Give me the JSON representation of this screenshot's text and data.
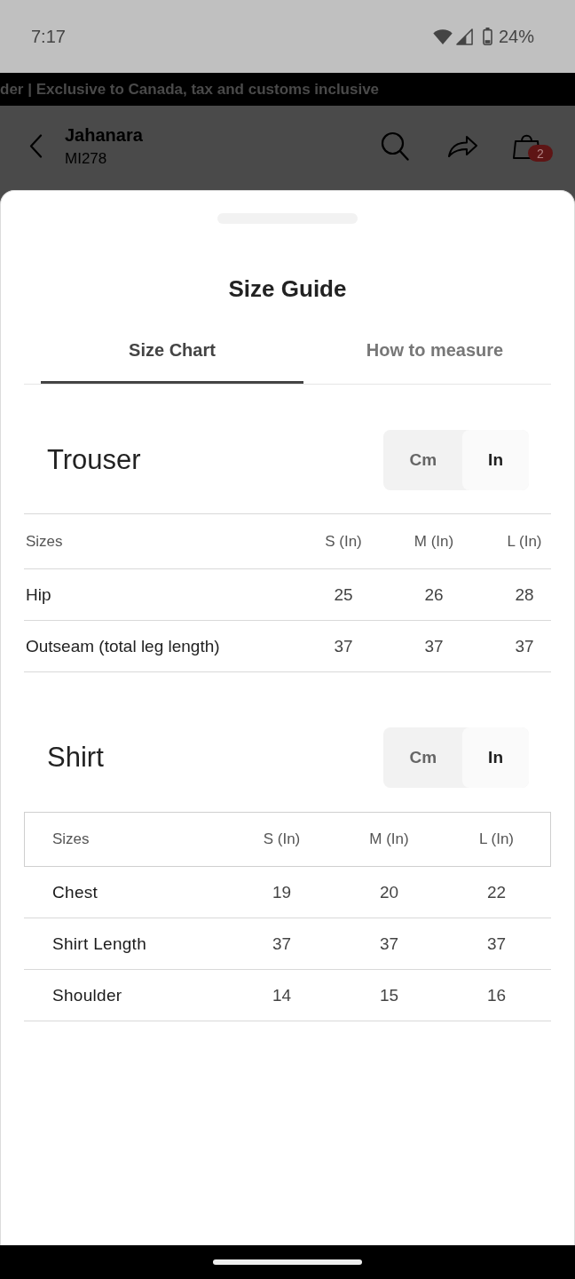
{
  "status_bar": {
    "time": "7:17",
    "battery": "24%"
  },
  "promo_bar": {
    "text": "der | Exclusive to Canada, tax and customs inclusive"
  },
  "header": {
    "title": "Jahanara",
    "subtitle": "MI278",
    "cart_count": "2"
  },
  "size_guide": {
    "title": "Size Guide",
    "tabs": [
      {
        "label": "Size Chart",
        "selected": true
      },
      {
        "label": "How to measure",
        "selected": false
      }
    ],
    "sections": [
      {
        "title": "Trouser",
        "kind": "plain",
        "units": [
          {
            "label": "Cm",
            "selected": false
          },
          {
            "label": "In",
            "selected": true
          }
        ],
        "columns": [
          "Sizes",
          "S (In)",
          "M (In)",
          "L (In)"
        ],
        "rows": [
          {
            "label": "Hip",
            "values": [
              "25",
              "26",
              "28"
            ]
          },
          {
            "label": "Outseam (total leg length)",
            "values": [
              "37",
              "37",
              "37"
            ]
          }
        ]
      },
      {
        "title": "Shirt",
        "kind": "boxed",
        "units": [
          {
            "label": "Cm",
            "selected": false
          },
          {
            "label": "In",
            "selected": true
          }
        ],
        "columns": [
          "Sizes",
          "S (In)",
          "M (In)",
          "L (In)"
        ],
        "rows": [
          {
            "label": "Chest",
            "values": [
              "19",
              "20",
              "22"
            ]
          },
          {
            "label": "Shirt Length",
            "values": [
              "37",
              "37",
              "37"
            ]
          },
          {
            "label": "Shoulder",
            "values": [
              "14",
              "15",
              "16"
            ]
          }
        ]
      }
    ]
  }
}
